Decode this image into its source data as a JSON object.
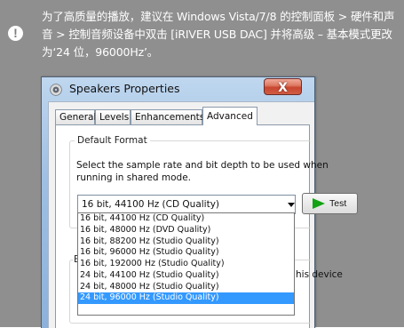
{
  "instruction": {
    "icon": "exclamation-icon",
    "text": "为了高质量的播放，建议在 Windows Vista/7/8 的控制面板 > 硬件和声音 > 控制音频设备中双击 [iRIVER USB DAC] 并将高级 – 基本模式更改为‘24 位，96000Hz’。"
  },
  "dialog": {
    "title": "Speakers Properties",
    "close_label": "X",
    "icons": {
      "title": "speaker-icon",
      "close": "close-icon",
      "dropdown": "chevron-down-icon",
      "test": "play-icon"
    },
    "tabs": [
      {
        "label": "General"
      },
      {
        "label": "Levels"
      },
      {
        "label": "Enhancements"
      },
      {
        "label": "Advanced"
      }
    ],
    "default_format": {
      "group_title": "Default Format",
      "description": "Select the sample rate and bit depth to be used when running in shared mode.",
      "selected_value": "16 bit, 44100 Hz (CD Quality)",
      "test_label": "Test",
      "options": [
        "16 bit, 44100 Hz (CD Quality)",
        "16 bit, 48000 Hz (DVD Quality)",
        "16 bit, 88200 Hz (Studio Quality)",
        "16 bit, 96000 Hz (Studio Quality)",
        "16 bit, 192000 Hz (Studio Quality)",
        "24 bit, 44100 Hz (Studio Quality)",
        "24 bit, 48000 Hz (Studio Quality)",
        "24 bit, 96000 Hz (Studio Quality)"
      ],
      "highlighted_option": "24 bit, 96000 Hz (Studio Quality)"
    },
    "exclusive_mode": {
      "title_visible": "E",
      "visible_text": "his device"
    }
  },
  "colors": {
    "note_background": "#8f8f8f",
    "window_frame": "#9fbfe3",
    "selection": "#3399ff",
    "close_button": "#c8462f",
    "play_icon": "#13a213"
  }
}
